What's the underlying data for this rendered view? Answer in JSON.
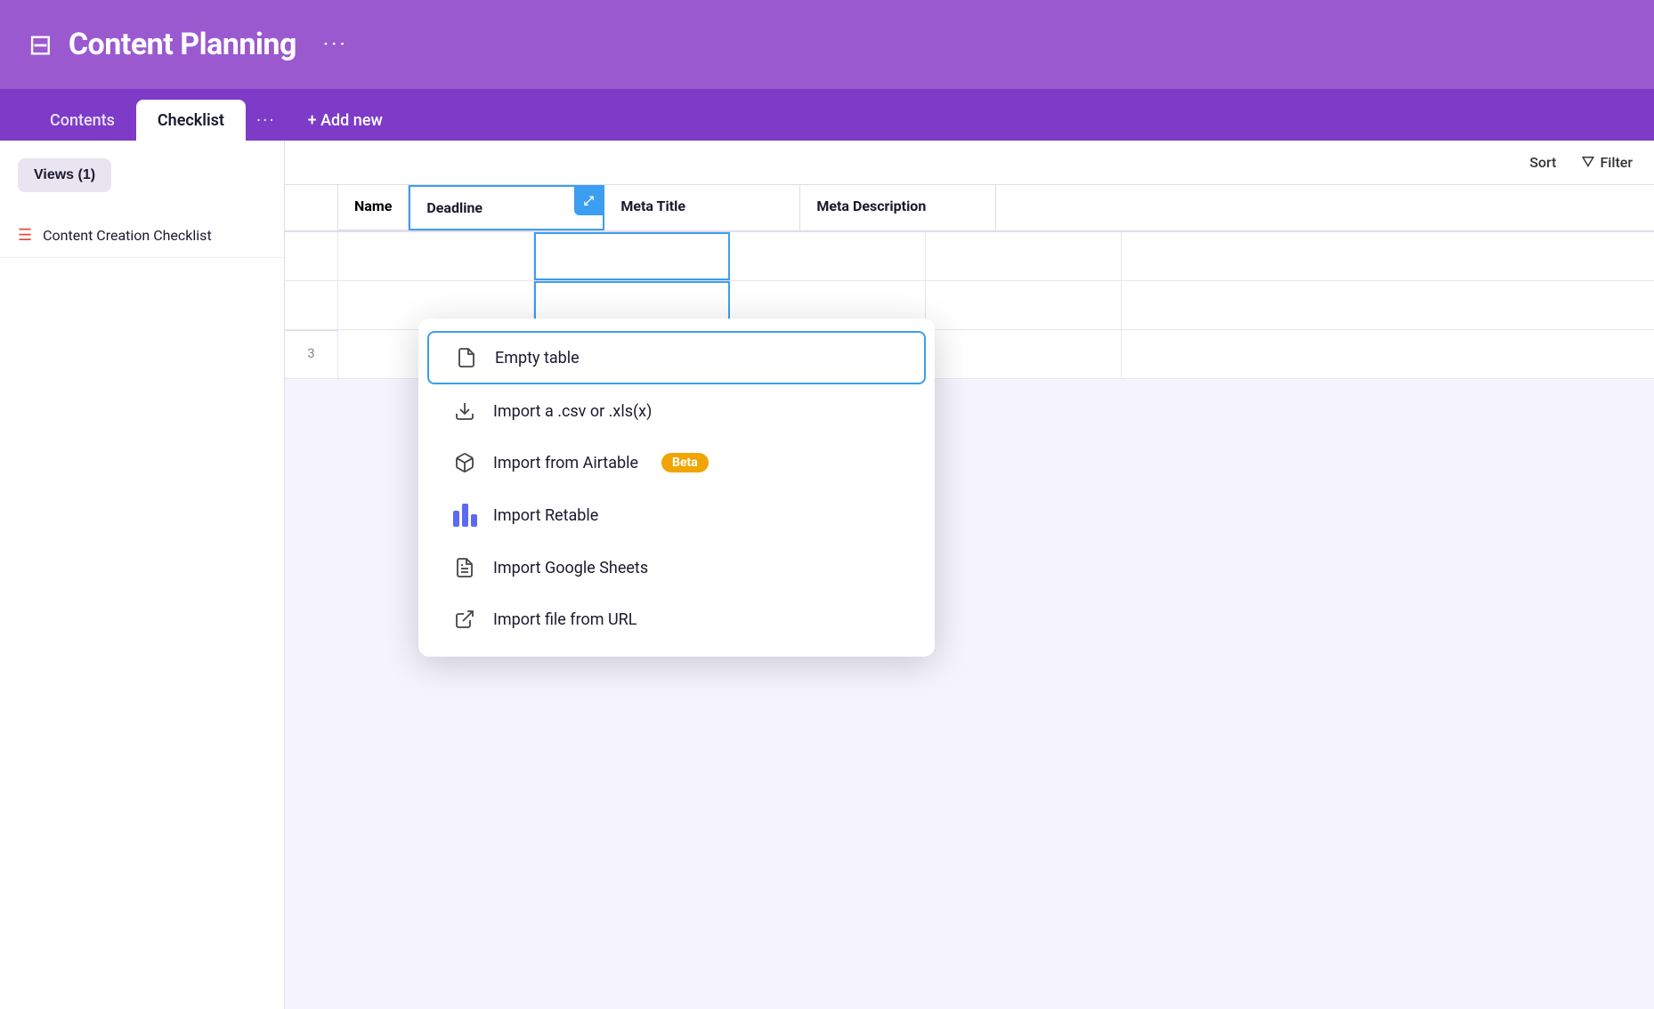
{
  "header": {
    "icon": "⊟",
    "title": "Content Planning",
    "more": "···"
  },
  "tabbar": {
    "tabs": [
      {
        "label": "Contents",
        "active": false
      },
      {
        "label": "Checklist",
        "active": true
      }
    ],
    "more": "···",
    "add_new": "+ Add new"
  },
  "sidebar": {
    "views_button": "Views (1)",
    "items": [
      {
        "label": "Content Creation Checklist",
        "icon": "≡"
      }
    ]
  },
  "toolbar": {
    "sort_label": "Sort",
    "filter_label": "Filter"
  },
  "columns": [
    {
      "label": "Name"
    },
    {
      "label": "Deadline",
      "highlighted": true
    },
    {
      "label": "Meta Title"
    },
    {
      "label": "Meta Description"
    }
  ],
  "table": {
    "row_number": "3"
  },
  "dropdown": {
    "items": [
      {
        "id": "empty-table",
        "label": "Empty table",
        "icon_type": "document",
        "selected": true
      },
      {
        "id": "import-csv",
        "label": "Import a .csv or .xls(x)",
        "icon_type": "download"
      },
      {
        "id": "import-airtable",
        "label": "Import from Airtable",
        "icon_type": "box",
        "badge": "Beta"
      },
      {
        "id": "import-retable",
        "label": "Import Retable",
        "icon_type": "retable"
      },
      {
        "id": "import-google-sheets",
        "label": "Import Google Sheets",
        "icon_type": "sheets"
      },
      {
        "id": "import-url",
        "label": "Import file from URL",
        "icon_type": "external"
      }
    ]
  },
  "colors": {
    "header_bg": "#9b59d0",
    "tabbar_bg": "#7d3bc8",
    "accent_blue": "#3b9ef0",
    "beta_badge": "#f0a500"
  }
}
